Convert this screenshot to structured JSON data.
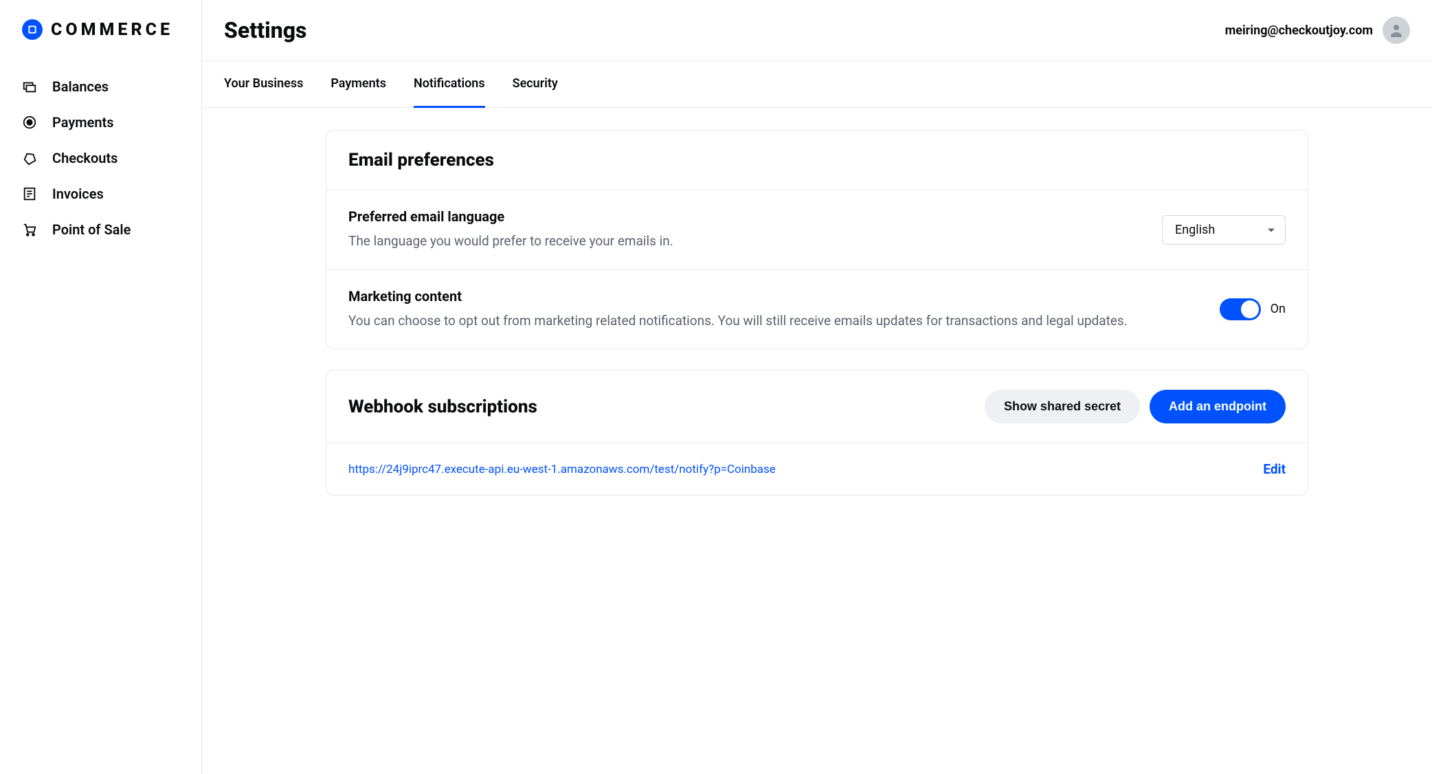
{
  "brand": {
    "name": "COMMERCE"
  },
  "sidebar": {
    "items": [
      {
        "label": "Balances"
      },
      {
        "label": "Payments"
      },
      {
        "label": "Checkouts"
      },
      {
        "label": "Invoices"
      },
      {
        "label": "Point of Sale"
      }
    ]
  },
  "header": {
    "title": "Settings",
    "user_email": "meiring@checkoutjoy.com"
  },
  "tabs": [
    {
      "label": "Your Business",
      "active": false
    },
    {
      "label": "Payments",
      "active": false
    },
    {
      "label": "Notifications",
      "active": true
    },
    {
      "label": "Security",
      "active": false
    }
  ],
  "email_prefs": {
    "title": "Email preferences",
    "language": {
      "title": "Preferred email language",
      "desc": "The language you would prefer to receive your emails in.",
      "selected": "English"
    },
    "marketing": {
      "title": "Marketing content",
      "desc": "You can choose to opt out from marketing related notifications. You will still receive emails updates for transactions and legal updates.",
      "state_label": "On",
      "state": true
    }
  },
  "webhooks": {
    "title": "Webhook subscriptions",
    "show_secret_label": "Show shared secret",
    "add_endpoint_label": "Add an endpoint",
    "endpoints": [
      {
        "url": "https://24j9iprc47.execute-api.eu-west-1.amazonaws.com/test/notify?p=Coinbase",
        "edit_label": "Edit"
      }
    ]
  }
}
